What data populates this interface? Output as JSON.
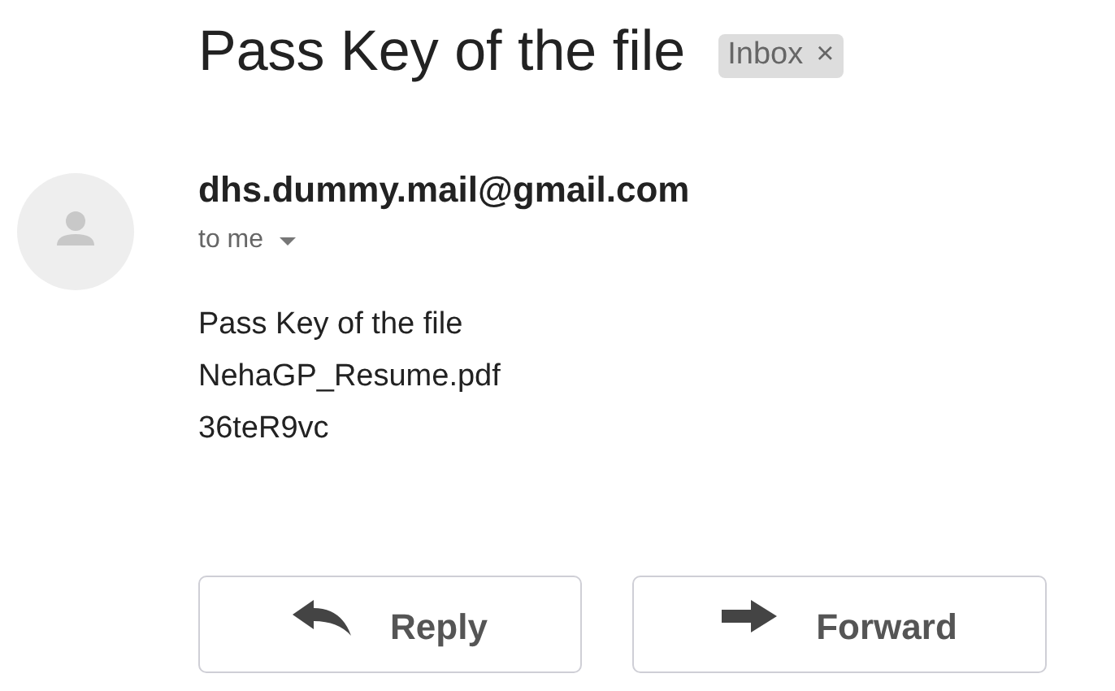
{
  "subject": "Pass Key of the file",
  "label": {
    "text": "Inbox",
    "remove": "×"
  },
  "sender": "dhs.dummy.mail@gmail.com",
  "recipient": "to me",
  "body_lines": [
    "Pass Key of the file",
    "NehaGP_Resume.pdf",
    "36teR9vc"
  ],
  "actions": [
    {
      "kind": "reply",
      "label": "Reply"
    },
    {
      "kind": "forward",
      "label": "Forward"
    }
  ]
}
